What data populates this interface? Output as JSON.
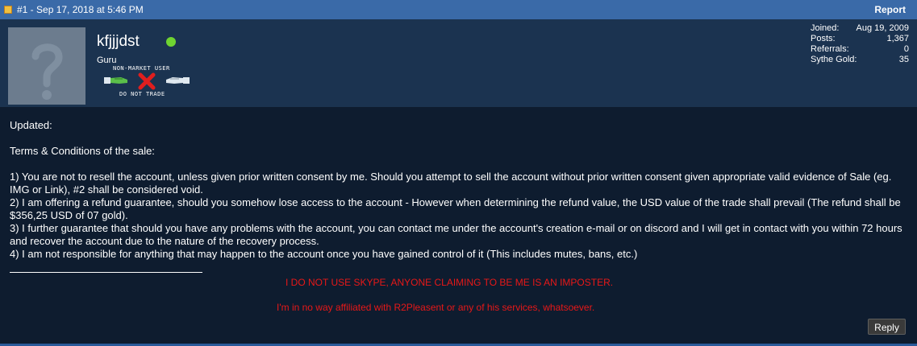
{
  "post": {
    "meta": "#1 - Sep 17, 2018 at 5:46 PM",
    "report_label": "Report"
  },
  "user": {
    "name": "kfjjjdst",
    "title": "Guru",
    "online_color": "#6fd431",
    "badge": {
      "top_text": "NON-MARKET USER",
      "bottom_text": "DO NOT TRADE"
    },
    "stats": [
      {
        "label": "Joined:",
        "value": "Aug 19, 2009"
      },
      {
        "label": "Posts:",
        "value": "1,367"
      },
      {
        "label": "Referrals:",
        "value": "0"
      },
      {
        "label": "Sythe Gold:",
        "value": "35"
      }
    ]
  },
  "body": {
    "updated": "Updated:",
    "terms_title": "Terms & Conditions of the sale:",
    "item1": "1) You are not to resell the account, unless given prior written consent by me. Should you attempt to sell the account without prior written consent given appropriate valid evidence of Sale (eg. IMG or Link), #2 shall be considered void.",
    "item2": "2) I am offering a refund guarantee, should you somehow lose access to the account - However when determining the refund value, the USD value of the trade shall prevail (The refund shall be $356,25 USD of 07 gold).",
    "item3": "3) I further guarantee that should you have any problems with the account, you can contact me under the account's creation e-mail or on discord and I will get in contact with you within 72 hours and recover the account due to the nature of the recovery process.",
    "item4": "4) I am not responsible for anything that may happen to the account once you have gained control of it (This includes mutes, bans, etc.)"
  },
  "signature": {
    "line1": "I DO NOT USE SKYPE, ANYONE CLAIMING TO BE ME IS AN IMPOSTER.",
    "line2": "I'm in no way affiliated with R2Pleasent or any of his services, whatsoever.",
    "color": "#e81818"
  },
  "actions": {
    "reply_label": "Reply"
  }
}
